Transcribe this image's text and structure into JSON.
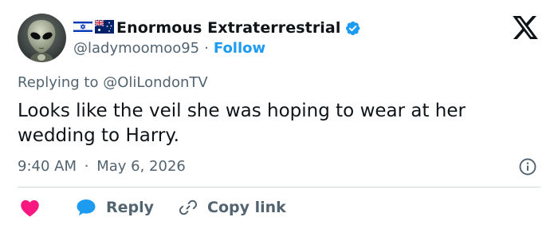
{
  "tweet": {
    "author": {
      "display_name": "Enormous Extraterrestrial",
      "handle": "@ladymoomoo95",
      "flags": [
        "israel-flag",
        "australia-flag"
      ],
      "verified": true
    },
    "follow_label": "Follow",
    "separator": "·",
    "replying_prefix": "Replying to",
    "replying_to": "@OliLondonTV",
    "text": "Looks like the veil she was hoping to wear at her wedding to Harry.",
    "time": "9:40 AM",
    "date": "May 6, 2026"
  },
  "actions": {
    "like_icon": "heart-icon",
    "reply_label": "Reply",
    "copy_label": "Copy link"
  },
  "colors": {
    "accent": "#1d9bf0",
    "like": "#f91880",
    "muted": "#536471",
    "text": "#0f1419"
  }
}
